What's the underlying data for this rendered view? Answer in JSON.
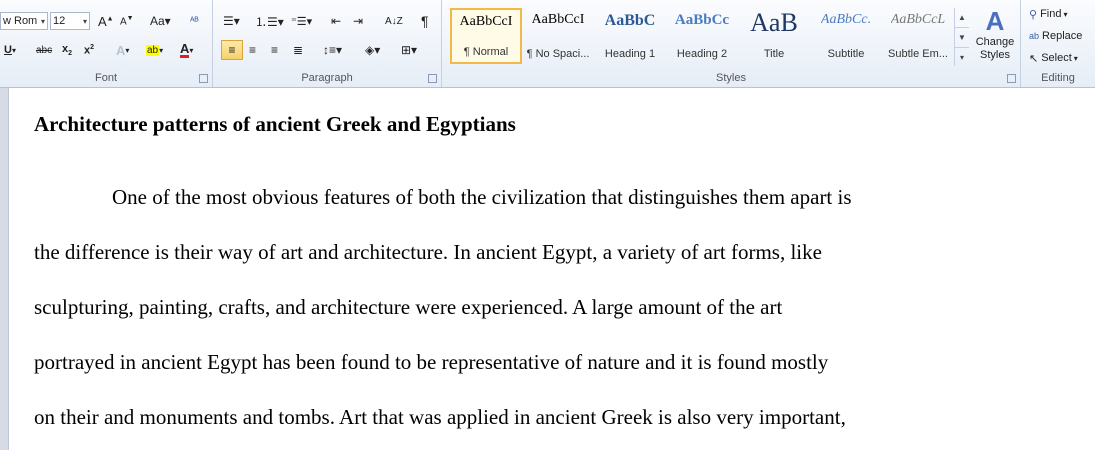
{
  "font_group": {
    "font_name": "w Rom",
    "font_size": "12",
    "label": "Font"
  },
  "paragraph_group": {
    "label": "Paragraph"
  },
  "styles_group": {
    "label": "Styles",
    "styles": [
      {
        "sample": "AaBbCcI",
        "name": "¶ Normal"
      },
      {
        "sample": "AaBbCcI",
        "name": "¶ No Spaci..."
      },
      {
        "sample": "AaBbC",
        "name": "Heading 1"
      },
      {
        "sample": "AaBbCc",
        "name": "Heading 2"
      },
      {
        "sample": "AaB",
        "name": "Title"
      },
      {
        "sample": "AaBbCc.",
        "name": "Subtitle"
      },
      {
        "sample": "AaBbCcL",
        "name": "Subtle Em..."
      }
    ],
    "change_styles": "Change Styles"
  },
  "editing_group": {
    "label": "Editing",
    "find": "Find",
    "replace": "Replace",
    "select": "Select"
  },
  "document": {
    "title": "Architecture patterns of ancient Greek and Egyptians",
    "lines": [
      "One of the most obvious features of both the civilization that distinguishes them apart is",
      "the difference is their way of art and architecture. In ancient Egypt, a variety of art forms, like",
      "sculpturing, painting, crafts, and architecture were experienced. A large amount of the art",
      "portrayed in ancient Egypt has been found to be representative of nature and it is found mostly",
      "on their and monuments and tombs. Art that was applied in ancient Greek is also very important,"
    ]
  }
}
